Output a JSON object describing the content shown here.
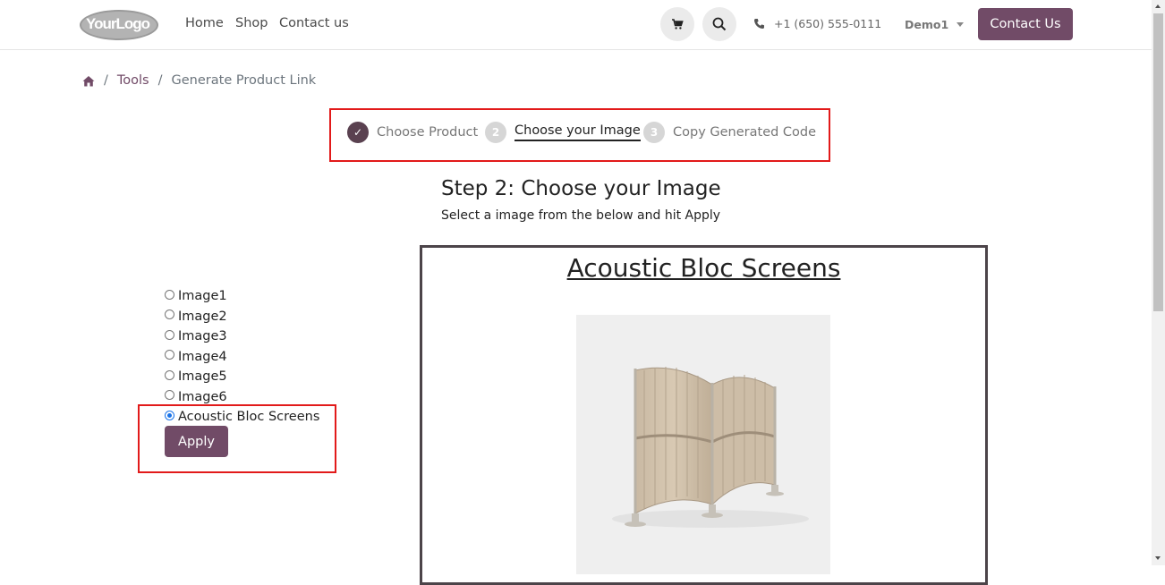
{
  "header": {
    "logo_text": "YourLogo",
    "nav": [
      "Home",
      "Shop",
      "Contact us"
    ],
    "phone": "+1 (650) 555-0111",
    "user": "Demo1",
    "contact_button": "Contact Us"
  },
  "breadcrumb": {
    "items": [
      "Tools",
      "Generate Product Link"
    ]
  },
  "steps": [
    {
      "number": "✓",
      "label": "Choose Product",
      "state": "done"
    },
    {
      "number": "2",
      "label": "Choose your Image",
      "state": "active"
    },
    {
      "number": "3",
      "label": "Copy Generated Code",
      "state": "todo"
    }
  ],
  "main": {
    "title": "Step 2: Choose your Image",
    "subtitle": "Select a image from the below and hit Apply"
  },
  "image_options": [
    {
      "label": "Image1",
      "checked": false
    },
    {
      "label": "Image2",
      "checked": false
    },
    {
      "label": "Image3",
      "checked": false
    },
    {
      "label": "Image4",
      "checked": false
    },
    {
      "label": "Image5",
      "checked": false
    },
    {
      "label": "Image6",
      "checked": false
    },
    {
      "label": "Acoustic Bloc Screens",
      "checked": true
    }
  ],
  "apply_button": "Apply",
  "preview": {
    "title": "Acoustic Bloc Screens"
  },
  "colors": {
    "brand": "#714b67",
    "highlight": "#e21a1a",
    "radio_selected": "#1a73e8"
  },
  "icons": [
    "cart-icon",
    "search-icon",
    "phone-icon",
    "home-icon",
    "check-icon"
  ]
}
